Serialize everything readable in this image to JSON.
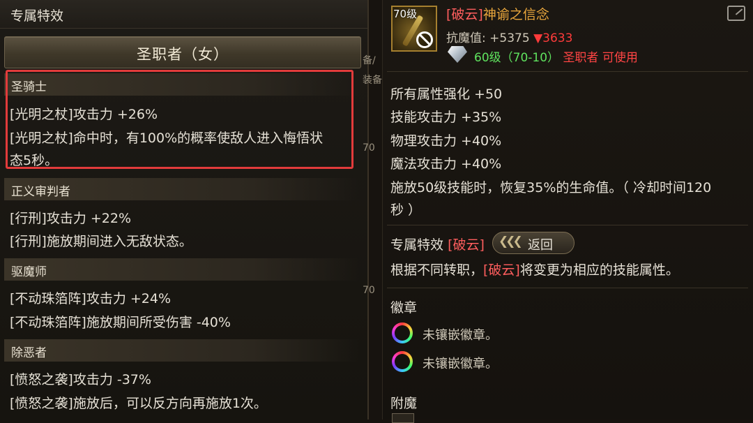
{
  "left": {
    "title": "专属特效",
    "class_name": "圣职者（女）",
    "sections": [
      {
        "name": "圣骑士",
        "lines": [
          "[光明之杖]攻击力 +26%",
          "[光明之杖]命中时，有100%的概率使敌人进入悔悟状",
          "态5秒。"
        ]
      },
      {
        "name": "正义审判者",
        "lines": [
          "[行刑]攻击力 +22%",
          "[行刑]施放期间进入无敌状态。"
        ]
      },
      {
        "name": "驱魔师",
        "lines": [
          "[不动珠箔阵]攻击力 +24%",
          "[不动珠箔阵]施放期间所受伤害 -40%"
        ]
      },
      {
        "name": "除恶者",
        "lines": [
          "[愤怒之袭]攻击力 -37%",
          "[愤怒之袭]施放后，可以反方向再施放1次。"
        ]
      }
    ],
    "peek_fragments": [
      "备/",
      "装备",
      "70",
      "70"
    ]
  },
  "item": {
    "level_label": "70级",
    "name_tag": "[破云]",
    "name": "神谕之信念",
    "resist_label": "抗魔值:",
    "resist_value": "+5375",
    "resist_down_arrow": "▼",
    "resist_down": "3633",
    "level_req": "60级（70-10）",
    "class_req": "圣职者 可使用"
  },
  "stats": [
    "所有属性强化 +50",
    "技能攻击力 +35%",
    "物理攻击力 +40%",
    "魔法攻击力 +40%",
    "施放50级技能时，恢复35%的生命值。（ 冷却时间120",
    "秒 ）"
  ],
  "exclusive": {
    "label": "专属特效",
    "tag": "[破云]",
    "return_label": "返回",
    "desc_before": "根据不同转职，",
    "desc_tag": "[破云]",
    "desc_after": "将变更为相应的技能属性。"
  },
  "badges": {
    "label": "徽章",
    "slots": [
      "未镶嵌徽章。",
      "未镶嵌徽章。"
    ]
  },
  "enchant": {
    "label": "附魔"
  },
  "icons": {
    "item": "staff-item-icon",
    "ban": "prohibited-icon",
    "gem": "diamond-icon",
    "popout": "popout-icon",
    "return": "chevrons-left-icon",
    "badge": "badge-slot-icon"
  },
  "colors": {
    "accent_red": "#ff5e5e",
    "highlight_border": "#e23b3b",
    "item_name": "#e9a63c",
    "level_green": "#5fe35f"
  }
}
